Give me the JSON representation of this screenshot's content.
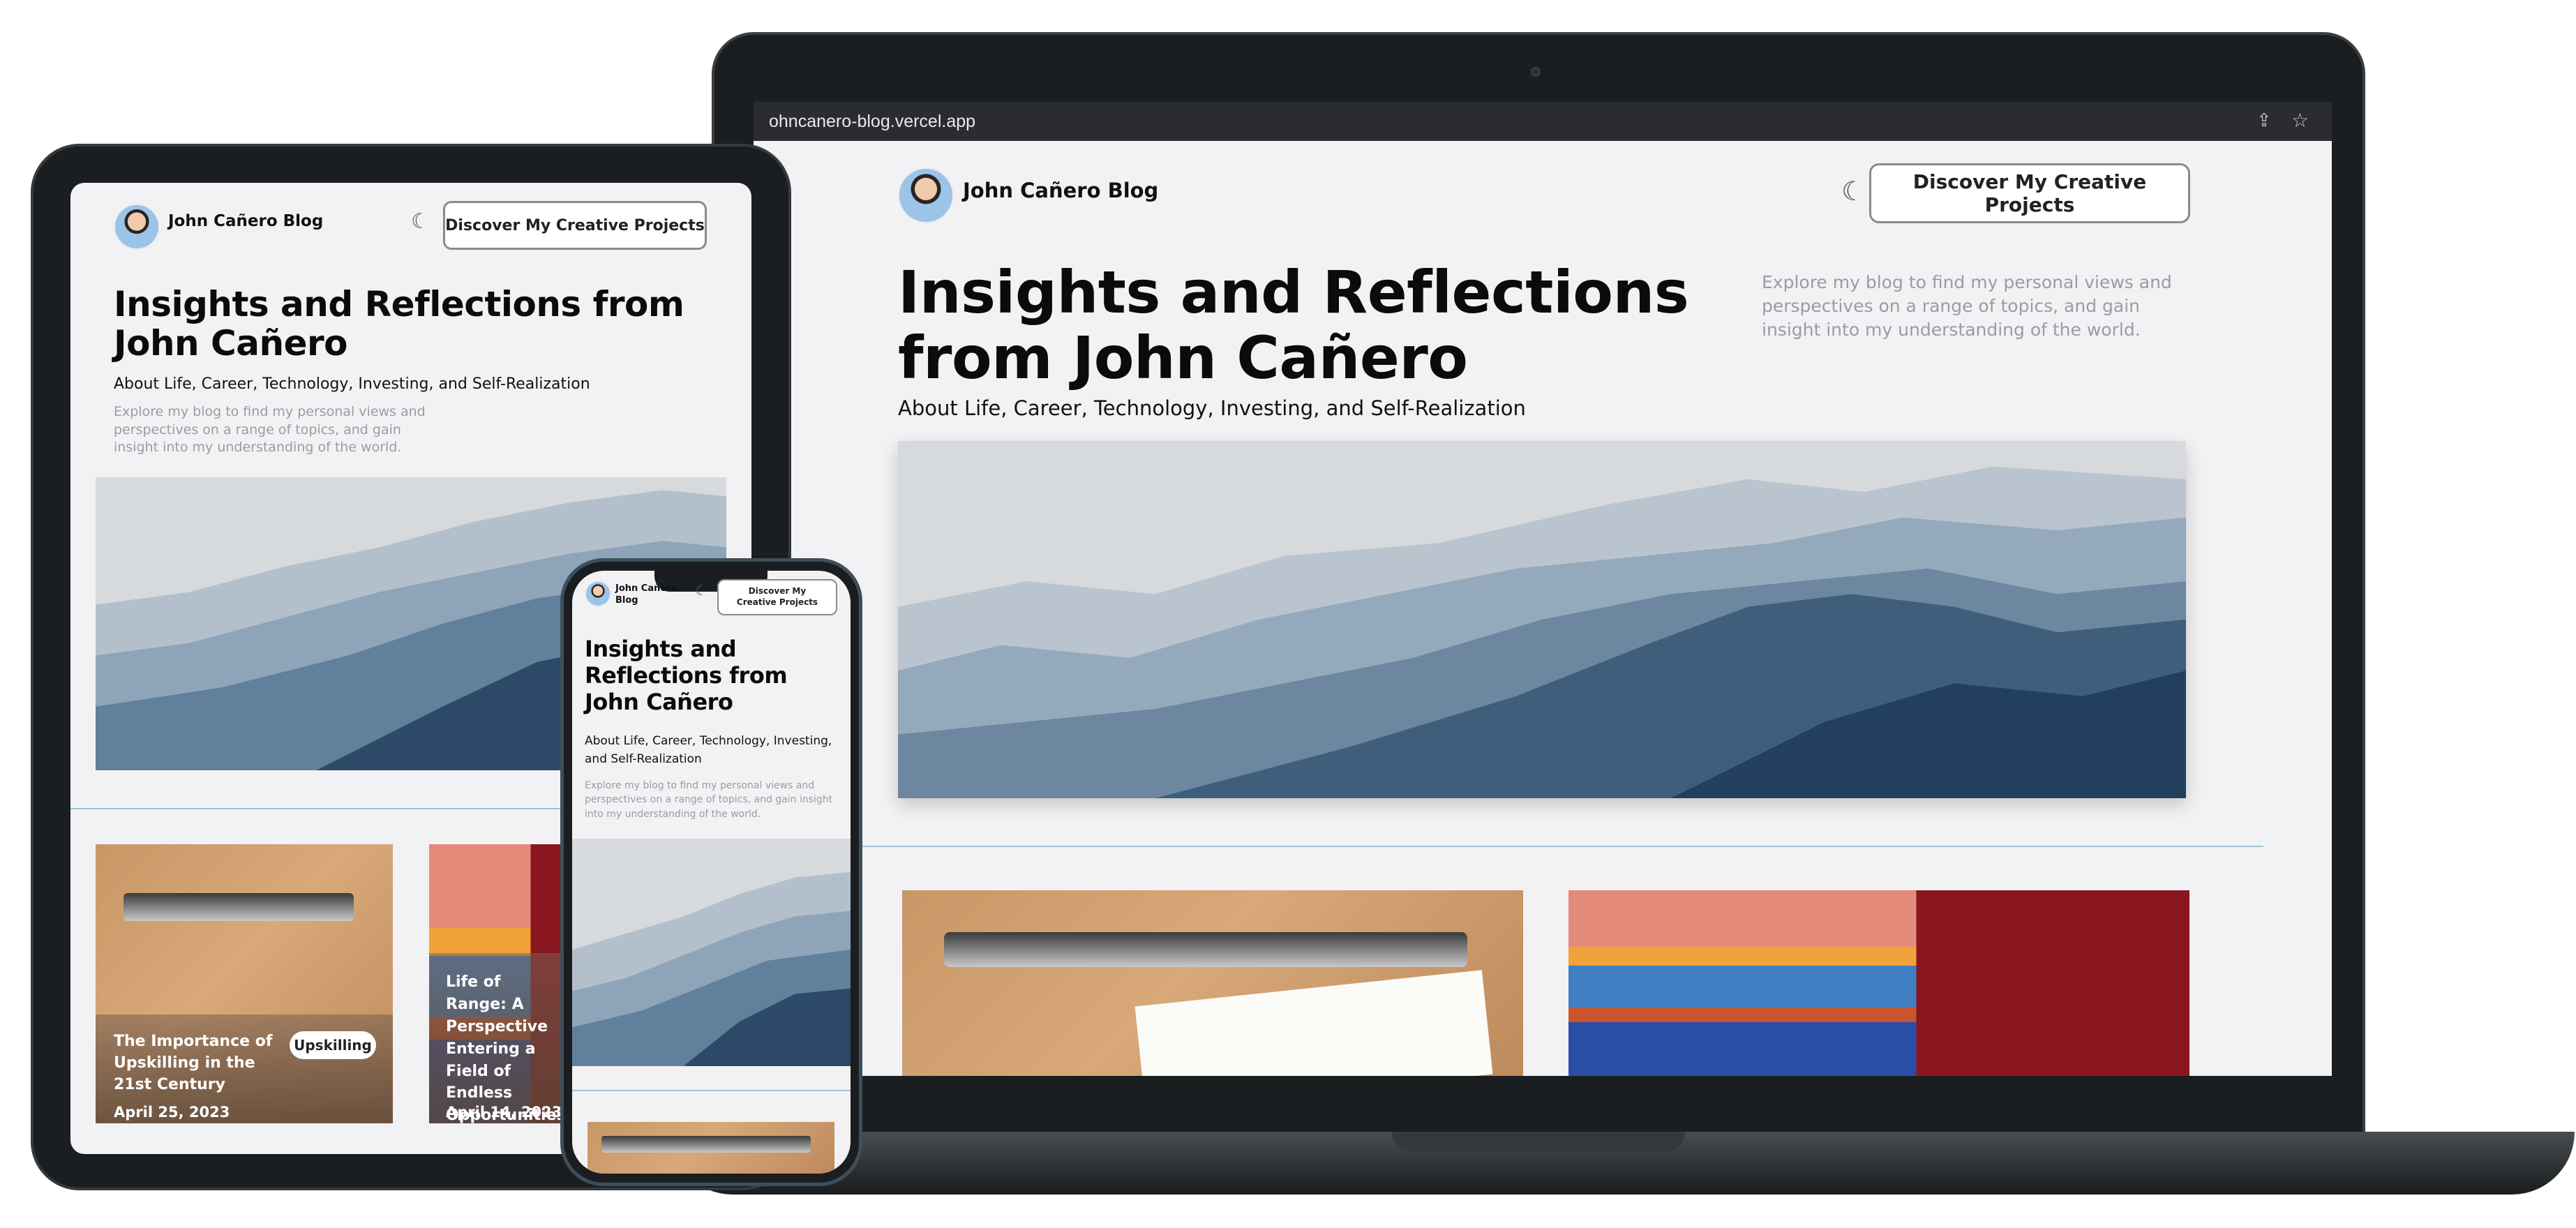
{
  "browser": {
    "url": "ohncanero-blog.vercel.app"
  },
  "site": {
    "brand": "John Cañero Blog",
    "brand_phone": "John Cañero Blog",
    "cta": "Discover My Creative Projects",
    "cta_phone": "Discover My Creative Projects",
    "title": "Insights and Reflections from John Cañero",
    "subtitle": "About Life, Career, Technology, Investing, and Self-Realization",
    "description": "Explore my blog to find my personal views and perspectives on a range of topics, and gain insight into my understanding of the world.",
    "theme_icon": "moon-icon"
  },
  "posts": [
    {
      "title": "The Importance of Upskilling in the 21st Century",
      "tag": "Upskilling",
      "date": "April 25, 2023"
    },
    {
      "title": "Life of Range: A Perspective Entering a Field of Endless Opportunities",
      "tag": "",
      "date": "April 14, 2023"
    }
  ],
  "colors": {
    "page_bg": "#f2f2f4",
    "device_frame": "#1d2022",
    "divider": "#9cc4d6",
    "description": "#9a9ca3"
  }
}
